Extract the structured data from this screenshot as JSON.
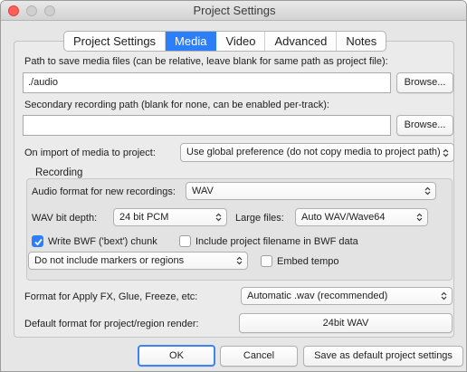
{
  "window": {
    "title": "Project Settings"
  },
  "tabs": [
    {
      "label": "Project Settings",
      "active": false
    },
    {
      "label": "Media",
      "active": true
    },
    {
      "label": "Video",
      "active": false
    },
    {
      "label": "Advanced",
      "active": false
    },
    {
      "label": "Notes",
      "active": false
    }
  ],
  "media": {
    "path_label": "Path to save media files (can be relative, leave blank for same path as project file):",
    "path_value": "./audio",
    "browse_label": "Browse...",
    "secondary_label": "Secondary recording path (blank for none, can be enabled per-track):",
    "secondary_value": "",
    "browse2_label": "Browse...",
    "import_label": "On import of media to project:",
    "import_value": "Use global preference (do not copy media to project path)"
  },
  "recording": {
    "group_label": "Recording",
    "format_label": "Audio format for new recordings:",
    "format_value": "WAV",
    "bitdepth_label": "WAV bit depth:",
    "bitdepth_value": "24 bit PCM",
    "largefiles_label": "Large files:",
    "largefiles_value": "Auto WAV/Wave64",
    "bwf_label": "Write BWF ('bext') chunk",
    "bwf_checked": true,
    "include_filename_label": "Include project filename in BWF data",
    "include_filename_checked": false,
    "markers_value": "Do not include markers or regions",
    "embed_tempo_label": "Embed tempo",
    "embed_tempo_checked": false
  },
  "render": {
    "apply_fx_label": "Format for Apply FX, Glue, Freeze, etc:",
    "apply_fx_value": "Automatic .wav (recommended)",
    "default_render_label": "Default format for project/region render:",
    "default_render_value": "24bit WAV"
  },
  "footer": {
    "ok_label": "OK",
    "cancel_label": "Cancel",
    "save_default_label": "Save as default project settings"
  },
  "colors": {
    "accent": "#2d7ff9",
    "close": "#ff5f57"
  }
}
